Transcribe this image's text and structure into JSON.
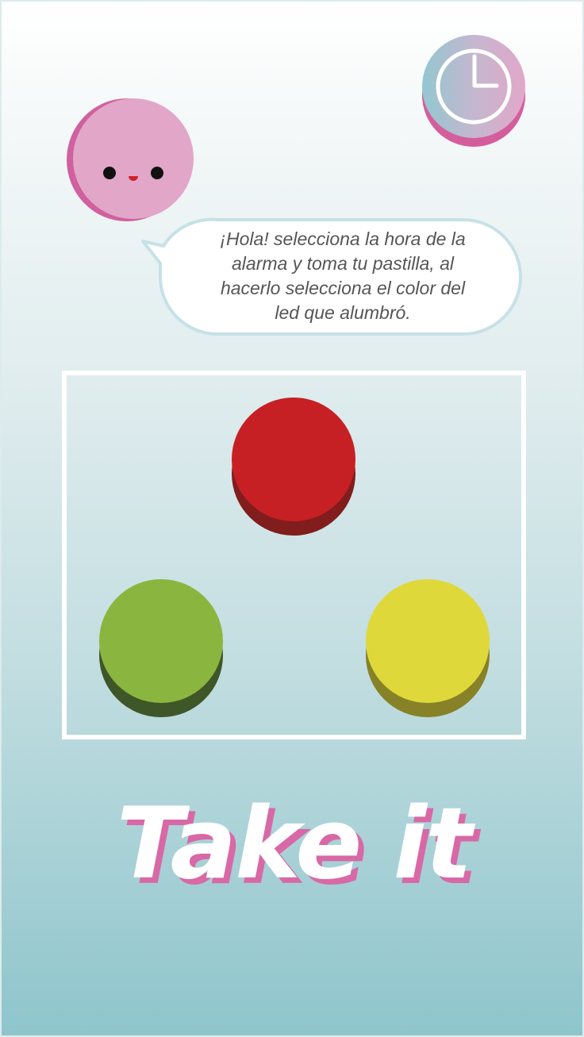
{
  "mascot": {
    "icon": "smiling-pill-character",
    "color": "#e2a6c8"
  },
  "clock_button": {
    "icon": "clock-icon"
  },
  "speech_bubble": {
    "lines": [
      "¡Hola!  selecciona la hora de la",
      "alarma y toma tu pastilla, al",
      "hacerlo selecciona el color del",
      "led que alumbró."
    ]
  },
  "led_panel": {
    "buttons": [
      {
        "name": "red",
        "color": "#c62024",
        "shade": "#811d1d"
      },
      {
        "name": "green",
        "color": "#8ab63f",
        "shade": "#3f5629"
      },
      {
        "name": "yellow",
        "color": "#dfd83a",
        "shade": "#878128"
      }
    ]
  },
  "title": {
    "text": "Take it",
    "color": "#ffffff",
    "shadow_color": "#d868a6"
  },
  "colors": {
    "background_top": "#ffffff",
    "background_bottom": "#8ec5cc",
    "bubble_border": "#c6e1e7"
  }
}
